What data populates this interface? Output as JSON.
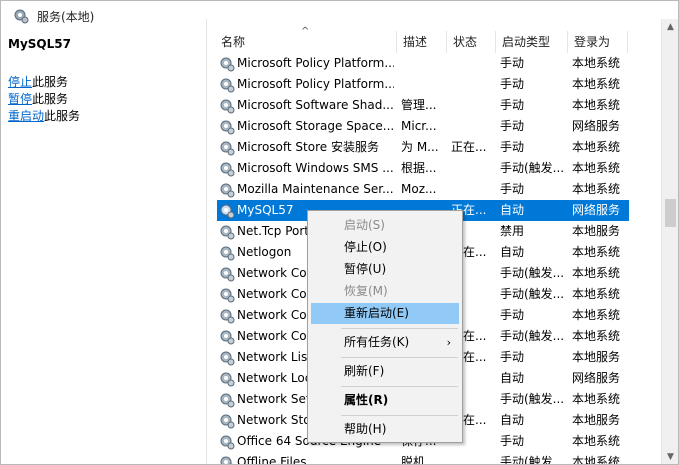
{
  "window": {
    "title": "服务(本地)"
  },
  "left_pane": {
    "service_name": "MySQL57",
    "actions": [
      {
        "link": "停止",
        "suffix": "此服务"
      },
      {
        "link": "暂停",
        "suffix": "此服务"
      },
      {
        "link": "重启动",
        "suffix": "此服务"
      }
    ]
  },
  "columns": {
    "name": "名称",
    "desc": "描述",
    "status": "状态",
    "startup": "启动类型",
    "logon": "登录为"
  },
  "rows": [
    {
      "name": "Microsoft Policy Platform...",
      "desc": "",
      "status": "",
      "startup": "手动",
      "logon": "本地系统"
    },
    {
      "name": "Microsoft Policy Platform...",
      "desc": "",
      "status": "",
      "startup": "手动",
      "logon": "本地系统"
    },
    {
      "name": "Microsoft Software Shad...",
      "desc": "管理...",
      "status": "",
      "startup": "手动",
      "logon": "本地系统"
    },
    {
      "name": "Microsoft Storage Space...",
      "desc": "Micr...",
      "status": "",
      "startup": "手动",
      "logon": "网络服务"
    },
    {
      "name": "Microsoft Store 安装服务",
      "desc": "为 M...",
      "status": "正在...",
      "startup": "手动",
      "logon": "本地系统"
    },
    {
      "name": "Microsoft Windows SMS ...",
      "desc": "根据...",
      "status": "",
      "startup": "手动(触发...",
      "logon": "本地系统"
    },
    {
      "name": "Mozilla Maintenance Ser...",
      "desc": "Moz...",
      "status": "",
      "startup": "手动",
      "logon": "本地系统"
    },
    {
      "name": "MySQL57",
      "desc": "",
      "status": "正在...",
      "startup": "自动",
      "logon": "网络服务"
    },
    {
      "name": "Net.Tcp Port",
      "desc": "",
      "status": "",
      "startup": "禁用",
      "logon": "本地服务"
    },
    {
      "name": "Netlogon",
      "desc": "",
      "status": "正在...",
      "startup": "自动",
      "logon": "本地系统"
    },
    {
      "name": "Network Co",
      "desc": "",
      "status": "",
      "startup": "手动(触发...",
      "logon": "本地系统"
    },
    {
      "name": "Network Co",
      "desc": "",
      "status": "",
      "startup": "手动(触发...",
      "logon": "本地系统"
    },
    {
      "name": "Network Co",
      "desc": "",
      "status": "",
      "startup": "手动",
      "logon": "本地系统"
    },
    {
      "name": "Network Co",
      "desc": "",
      "status": "正在...",
      "startup": "手动(触发...",
      "logon": "本地系统"
    },
    {
      "name": "Network List",
      "desc": "",
      "status": "正在...",
      "startup": "手动",
      "logon": "本地服务"
    },
    {
      "name": "Network Loc",
      "desc": "",
      "status": "",
      "startup": "自动",
      "logon": "网络服务"
    },
    {
      "name": "Network Set",
      "desc": "",
      "status": "",
      "startup": "手动(触发...",
      "logon": "本地系统"
    },
    {
      "name": "Network Sto",
      "desc": "",
      "status": "正在...",
      "startup": "自动",
      "logon": "本地服务"
    },
    {
      "name": "Office 64 Source Engine",
      "desc": "保存...",
      "status": "",
      "startup": "手动",
      "logon": "本地系统"
    },
    {
      "name": "Offline Files",
      "desc": "脱机...",
      "status": "",
      "startup": "手动(触发...",
      "logon": "本地系统"
    }
  ],
  "selected_row_index": 7,
  "context_menu": {
    "items": [
      {
        "label": "启动(S)",
        "disabled": true
      },
      {
        "label": "停止(O)"
      },
      {
        "label": "暂停(U)"
      },
      {
        "label": "恢复(M)",
        "disabled": true
      },
      {
        "label": "重新启动(E)",
        "highlight": true
      },
      {
        "label": "所有任务(K)",
        "submenu": true
      },
      {
        "label": "刷新(F)"
      },
      {
        "label": "属性(R)",
        "bold": true
      },
      {
        "label": "帮助(H)"
      }
    ]
  },
  "icons": {
    "service": "gear-icon",
    "title": "services-icon"
  },
  "colors": {
    "selection": "#0078d7",
    "menu_highlight": "#91c9f7",
    "link": "#0066cc"
  }
}
